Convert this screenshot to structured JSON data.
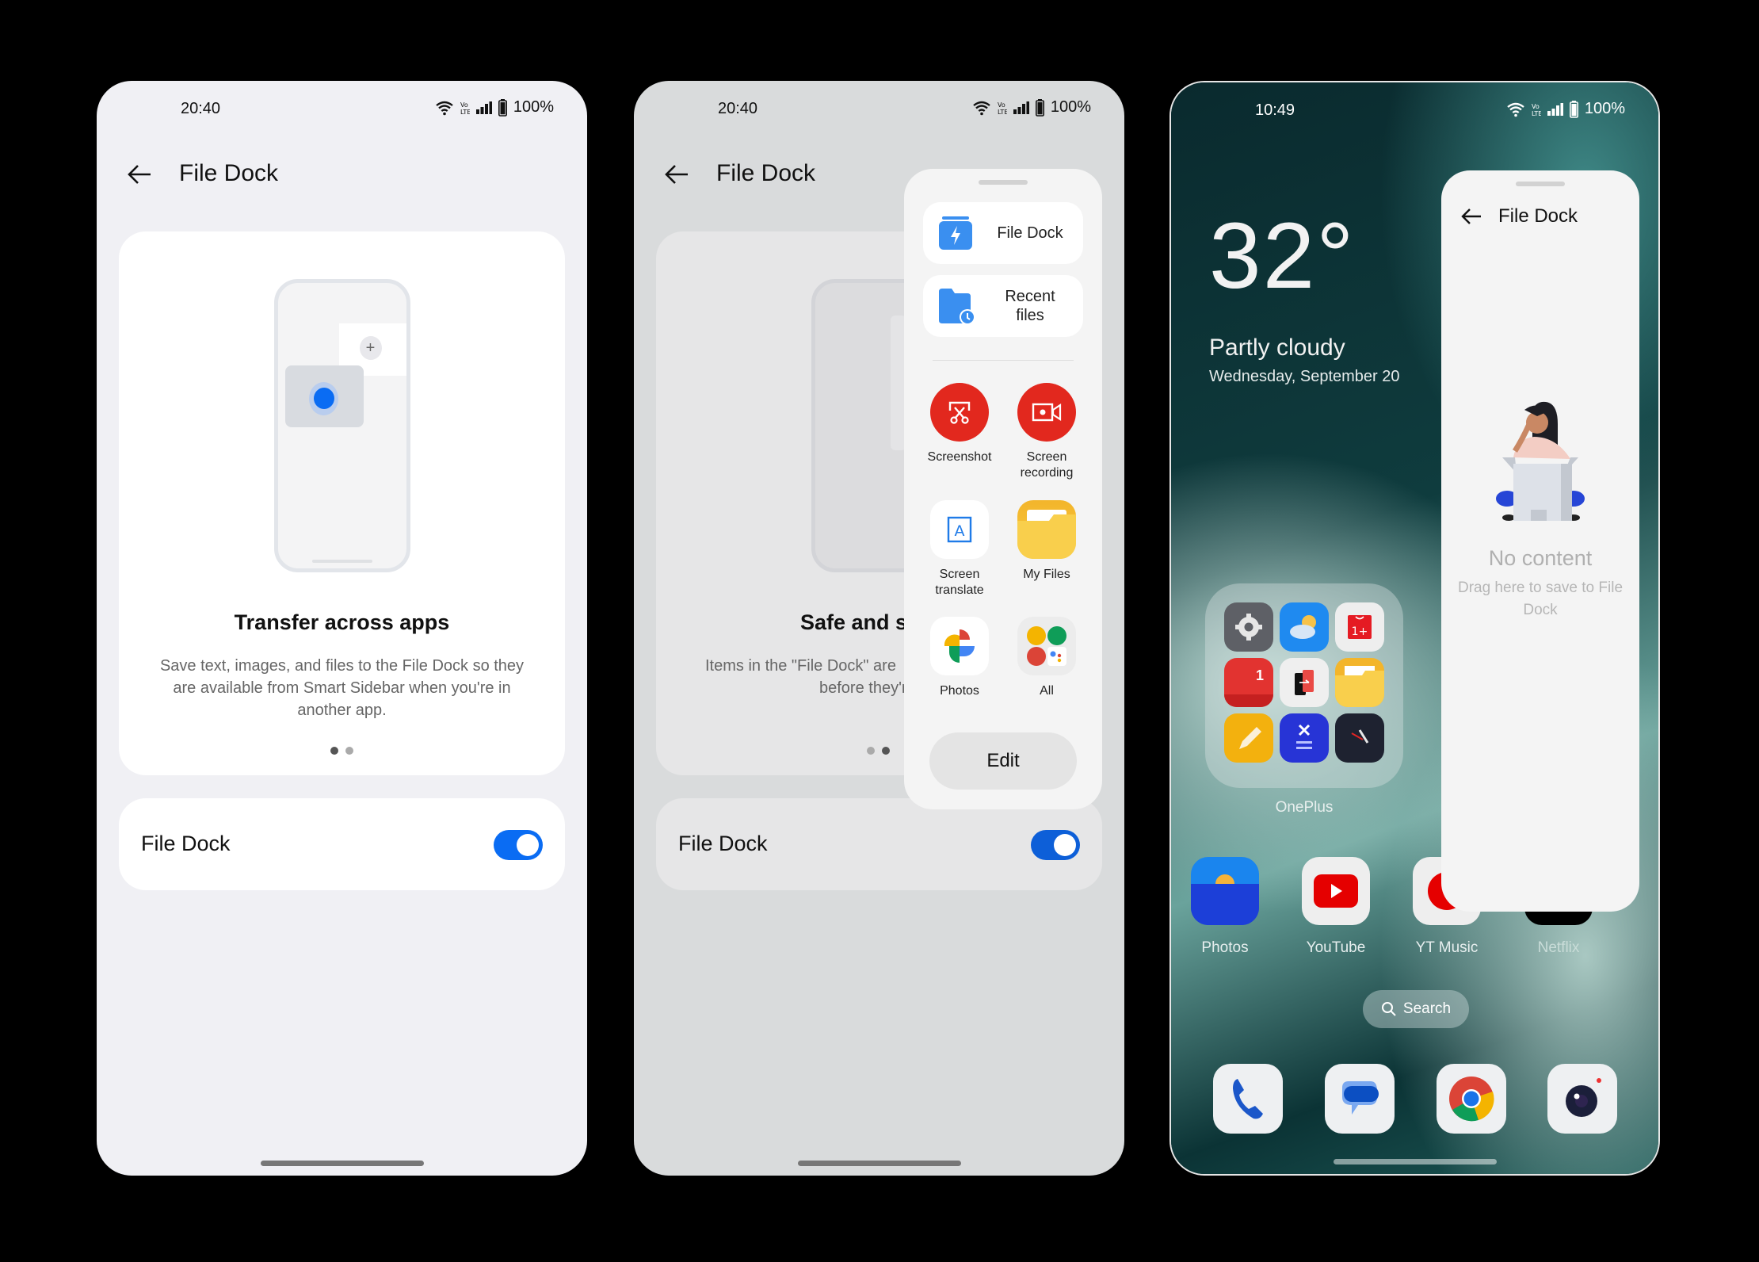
{
  "screens": [
    {
      "status": {
        "time": "20:40",
        "battery": "100%",
        "network": "VoLTE"
      },
      "header": {
        "title": "File Dock",
        "back_icon": "arrow-left-icon"
      },
      "onboarding": {
        "title": "Transfer across apps",
        "description": "Save text, images, and files to the File Dock so they are available from Smart Sidebar when you're in another app.",
        "page_index": 1,
        "page_count": 2
      },
      "setting": {
        "label": "File Dock",
        "enabled": true
      }
    },
    {
      "status": {
        "time": "20:40",
        "battery": "100%",
        "network": "VoLTE"
      },
      "header": {
        "title": "File Dock",
        "back_icon": "arrow-left-icon"
      },
      "onboarding": {
        "title": "Safe and s",
        "description_line1": "Items in the \"File Dock\" are",
        "description_line2": "before they're",
        "page_index": 2,
        "page_count": 2
      },
      "setting": {
        "label": "File Dock",
        "enabled": true
      },
      "sidebar": {
        "tiles": [
          {
            "label": "File Dock",
            "icon": "file-dock-icon"
          },
          {
            "label": "Recent files",
            "icon": "recent-files-icon"
          }
        ],
        "apps": [
          {
            "label": "Screenshot",
            "icon": "screenshot-icon"
          },
          {
            "label": "Screen recording",
            "icon": "screen-recording-icon"
          },
          {
            "label": "Screen translate",
            "icon": "screen-translate-icon"
          },
          {
            "label": "My Files",
            "icon": "my-files-icon"
          },
          {
            "label": "Photos",
            "icon": "google-photos-icon"
          },
          {
            "label": "All",
            "icon": "all-apps-icon"
          }
        ],
        "edit_label": "Edit"
      }
    },
    {
      "status": {
        "time": "10:49",
        "battery": "100%",
        "network": "VoLTE"
      },
      "weather": {
        "temperature": "32°",
        "condition": "Partly cloudy",
        "date": "Wednesday, September 20"
      },
      "folder": {
        "label": "OnePlus",
        "apps": [
          "settings-icon",
          "weather-icon",
          "oneplus-store-icon",
          "calendar-icon",
          "clone-phone-icon",
          "file-manager-icon",
          "notes-icon",
          "calculator-icon",
          "clock-icon"
        ],
        "calendar_day": "1"
      },
      "row_apps": [
        {
          "label": "Photos",
          "icon": "photos-icon"
        },
        {
          "label": "YouTube",
          "icon": "youtube-icon"
        },
        {
          "label": "YT Music",
          "icon": "yt-music-icon"
        },
        {
          "label": "Netflix",
          "icon": "netflix-icon"
        }
      ],
      "search": {
        "label": "Search"
      },
      "dock": [
        "phone-icon",
        "messages-icon",
        "chrome-icon",
        "camera-icon"
      ],
      "sidebar": {
        "title": "File Dock",
        "empty_title": "No content",
        "empty_subtitle": "Drag here to save to File Dock"
      }
    }
  ],
  "colors": {
    "accent": "#0a6cf3",
    "record_red": "#e2281e",
    "folder_blue": "#3a8ff0"
  }
}
